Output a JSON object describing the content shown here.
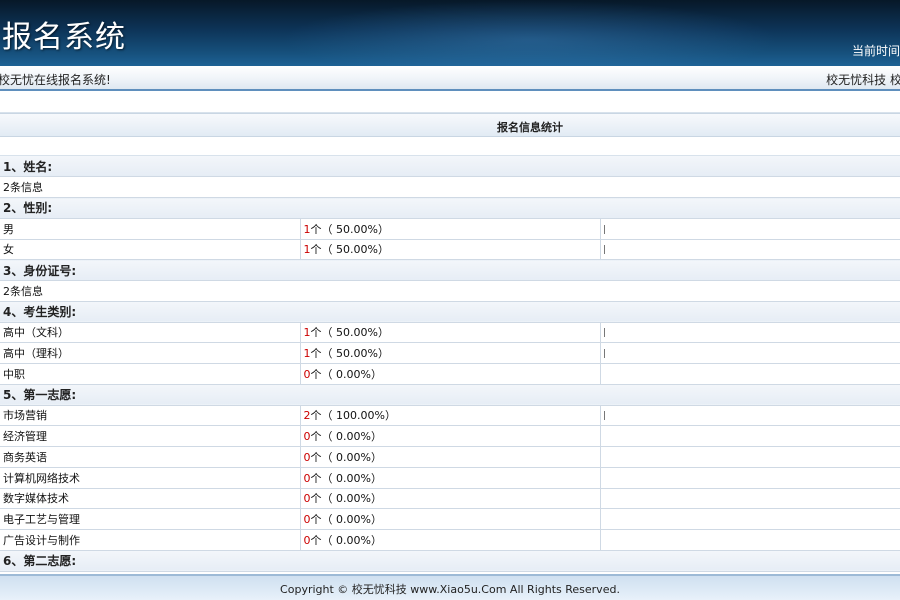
{
  "header": {
    "title": "报名系统",
    "time_label": "当前时间"
  },
  "subbar": {
    "welcome": "校无忧在线报名系统!",
    "brand": "校无忧科技 校"
  },
  "section_title": "报名信息统计",
  "questions": [
    {
      "label": "1、姓名:",
      "summary": "2条信息"
    },
    {
      "label": "2、性别:",
      "options": [
        {
          "name": "男",
          "count": "1",
          "pct": "个（ 50.00%）",
          "bar": true
        },
        {
          "name": "女",
          "count": "1",
          "pct": "个（ 50.00%）",
          "bar": true
        }
      ]
    },
    {
      "label": "3、身份证号:",
      "summary": "2条信息"
    },
    {
      "label": "4、考生类别:",
      "options": [
        {
          "name": "高中（文科）",
          "count": "1",
          "pct": "个（ 50.00%）",
          "bar": true
        },
        {
          "name": "高中（理科）",
          "count": "1",
          "pct": "个（ 50.00%）",
          "bar": true
        },
        {
          "name": "中职",
          "count": "0",
          "pct": "个（ 0.00%）",
          "bar": false
        }
      ]
    },
    {
      "label": "5、第一志愿:",
      "options": [
        {
          "name": "市场营销",
          "count": "2",
          "pct": "个（ 100.00%）",
          "bar": true
        },
        {
          "name": "经济管理",
          "count": "0",
          "pct": "个（ 0.00%）",
          "bar": false
        },
        {
          "name": "商务英语",
          "count": "0",
          "pct": "个（ 0.00%）",
          "bar": false
        },
        {
          "name": "计算机网络技术",
          "count": "0",
          "pct": "个（ 0.00%）",
          "bar": false
        },
        {
          "name": "数字媒体技术",
          "count": "0",
          "pct": "个（ 0.00%）",
          "bar": false
        },
        {
          "name": "电子工艺与管理",
          "count": "0",
          "pct": "个（ 0.00%）",
          "bar": false
        },
        {
          "name": "广告设计与制作",
          "count": "0",
          "pct": "个（ 0.00%）",
          "bar": false
        }
      ]
    },
    {
      "label": "6、第二志愿:"
    }
  ],
  "footer": {
    "text": "Copyright © 校无忧科技  www.Xiao5u.Com All Rights Reserved."
  }
}
